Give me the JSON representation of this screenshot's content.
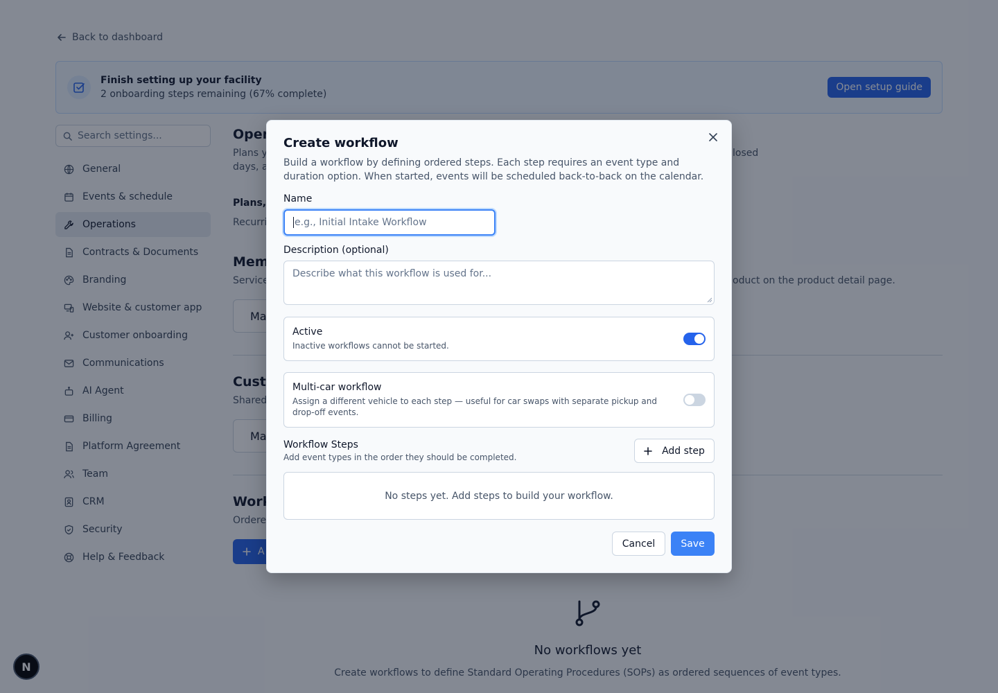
{
  "background": {
    "back_link": "Back to dashboard",
    "setup_banner": {
      "title": "Finish setting up your facility",
      "subtitle": "2 onboarding steps remaining (67% complete)",
      "button": "Open setup guide"
    },
    "search": {
      "placeholder": "Search settings..."
    },
    "sidebar": {
      "items": [
        {
          "label": "General",
          "icon": "globe-icon"
        },
        {
          "label": "Events & schedule",
          "icon": "calendar-icon"
        },
        {
          "label": "Operations",
          "icon": "wrench-icon",
          "active": true
        },
        {
          "label": "Contracts & Documents",
          "icon": "document-icon"
        },
        {
          "label": "Branding",
          "icon": "palette-icon"
        },
        {
          "label": "Website & customer app",
          "icon": "devices-icon"
        },
        {
          "label": "Customer onboarding",
          "icon": "user-plus-icon"
        },
        {
          "label": "Communications",
          "icon": "mail-icon"
        },
        {
          "label": "AI Agent",
          "icon": "bot-icon"
        },
        {
          "label": "Billing",
          "icon": "credit-card-icon"
        },
        {
          "label": "Platform Agreement",
          "icon": "document-icon"
        },
        {
          "label": "Team",
          "icon": "users-icon"
        },
        {
          "label": "CRM",
          "icon": "contacts-icon"
        },
        {
          "label": "Security",
          "icon": "shield-icon"
        },
        {
          "label": "Help & Feedback",
          "icon": "lifebuoy-icon"
        }
      ]
    },
    "main": {
      "operations_title": "Oper",
      "operations_sub_left_1": "Plans y",
      "operations_sub_right": "losed",
      "operations_sub_left_2": "days, a",
      "plans_heading": "Plans, c",
      "plans_sub": "Recurri",
      "membership_title": "Mem",
      "membership_sub_left": "Service",
      "membership_sub_right": "oduct on the product detail page.",
      "membership_button": "Ma",
      "custom_title": "Custo",
      "custom_sub": "Shared",
      "custom_button": "Ma",
      "workflows_title": "Work",
      "workflows_sub": "Ordere",
      "workflows_add_label": "A",
      "empty_title": "No workflows yet",
      "empty_sub": "Create workflows to define Standard Operating Procedures (SOPs) as ordered sequences of event types."
    },
    "badge_letter": "N"
  },
  "modal": {
    "title": "Create workflow",
    "description": "Build a workflow by defining ordered steps. Each step requires an event type and duration option. When started, events will be scheduled back-to-back on the calendar.",
    "name_label": "Name",
    "name_placeholder": "e.g., Initial Intake Workflow",
    "name_value": "",
    "description_label": "Description (optional)",
    "description_placeholder": "Describe what this workflow is used for...",
    "active": {
      "title": "Active",
      "subtitle": "Inactive workflows cannot be started.",
      "enabled": true
    },
    "multi_car": {
      "title": "Multi-car workflow",
      "subtitle": "Assign a different vehicle to each step — useful for car swaps with separate pickup and drop-off events.",
      "enabled": false
    },
    "steps": {
      "title": "Workflow Steps",
      "subtitle": "Add event types in the order they should be completed.",
      "add_button": "Add step",
      "empty": "No steps yet. Add steps to build your workflow."
    },
    "cancel": "Cancel",
    "save": "Save"
  },
  "colors": {
    "primary": "#2563eb",
    "save": "#3b82f6",
    "overlay": "rgba(15, 23, 42, 0.5)"
  }
}
